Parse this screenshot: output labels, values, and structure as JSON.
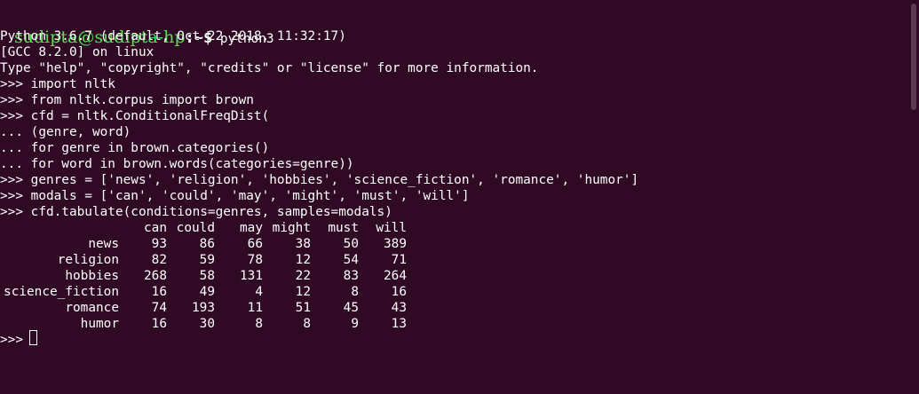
{
  "prompt": {
    "user_host": "sudipta@sudipta-hp",
    "path": ":~$",
    "command": " python3"
  },
  "output_lines": [
    "Python 3.6.7 (default, Oct 22 2018, 11:32:17)",
    "[GCC 8.2.0] on linux",
    "Type \"help\", \"copyright\", \"credits\" or \"license\" for more information.",
    ">>> import nltk",
    ">>> from nltk.corpus import brown",
    ">>> cfd = nltk.ConditionalFreqDist(",
    "... (genre, word)",
    "... for genre in brown.categories()",
    "... for word in brown.words(categories=genre))",
    ">>> genres = ['news', 'religion', 'hobbies', 'science_fiction', 'romance', 'humor']",
    ">>> modals = ['can', 'could', 'may', 'might', 'must', 'will']",
    ">>> cfd.tabulate(conditions=genres, samples=modals)"
  ],
  "table": {
    "columns": [
      "can",
      "could",
      "may",
      "might",
      "must",
      "will"
    ],
    "rows": [
      {
        "label": "news",
        "values": [
          "93",
          "86",
          "66",
          "38",
          "50",
          "389"
        ]
      },
      {
        "label": "religion",
        "values": [
          "82",
          "59",
          "78",
          "12",
          "54",
          "71"
        ]
      },
      {
        "label": "hobbies",
        "values": [
          "268",
          "58",
          "131",
          "22",
          "83",
          "264"
        ]
      },
      {
        "label": "science_fiction",
        "values": [
          "16",
          "49",
          "4",
          "12",
          "8",
          "16"
        ]
      },
      {
        "label": "romance",
        "values": [
          "74",
          "193",
          "11",
          "51",
          "45",
          "43"
        ]
      },
      {
        "label": "humor",
        "values": [
          "16",
          "30",
          "8",
          "8",
          "9",
          "13"
        ]
      }
    ]
  },
  "final_prompt": ">>> ",
  "colors": {
    "background": "#300a24",
    "text": "#ffffff",
    "prompt_user": "#4ee44e"
  }
}
